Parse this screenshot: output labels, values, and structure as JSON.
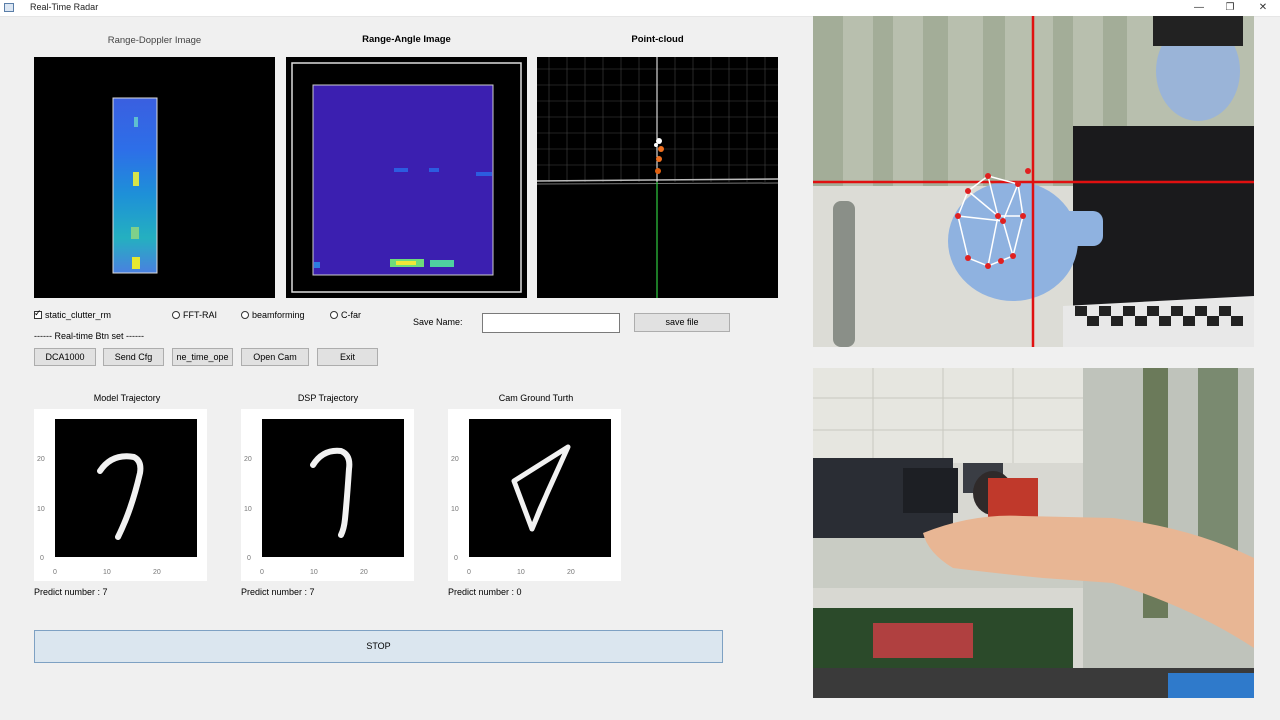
{
  "window": {
    "title": "Real-Time Radar",
    "minimize": "—",
    "restore": "❐",
    "close": "✕"
  },
  "panels": {
    "range_doppler": "Range-Doppler Image",
    "range_angle": "Range-Angle Image",
    "point_cloud": "Point-cloud"
  },
  "options": {
    "static_clutter_rm": "static_clutter_rm",
    "fft_rai": "FFT-RAI",
    "beamforming": "beamforming",
    "cfar": "C-far"
  },
  "save": {
    "label": "Save Name:",
    "value": "",
    "button": "save file"
  },
  "realtime": {
    "section_label": "------ Real-time Btn set ------"
  },
  "buttons": {
    "dca1000": "DCA1000",
    "send_cfg": "Send Cfg",
    "one_time": "ne_time_ope",
    "open_cam": "Open Cam",
    "exit": "Exit"
  },
  "trajectories": [
    {
      "title": "Model Trajectory",
      "predict": "Predict number : 7"
    },
    {
      "title": "DSP Trajectory",
      "predict": "Predict number : 7"
    },
    {
      "title": "Cam Ground Turth",
      "predict": "Predict number : 0"
    }
  ],
  "axis": {
    "y_ticks": [
      "20",
      "10",
      "0"
    ],
    "x_ticks": [
      "0",
      "10",
      "20"
    ]
  },
  "stop_label": "STOP",
  "colors": {
    "accent_blue": "#3b1fb0",
    "stop_bg": "#dbe6ef",
    "crosshair_red": "#e01010",
    "axis_green": "#2ecc40"
  }
}
